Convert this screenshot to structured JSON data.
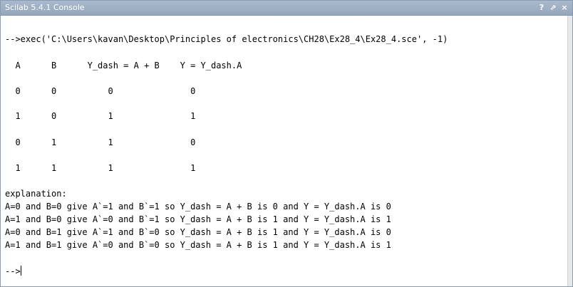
{
  "window": {
    "title": "Scilab 5.4.1 Console",
    "controls": {
      "help": "?",
      "undock": "⇗",
      "close": "×"
    }
  },
  "console": {
    "command": "-->exec('C:\\Users\\kavan\\Desktop\\Principles of electronics\\CH28\\Ex28_4\\Ex28_4.sce', -1)",
    "table_header": "  A      B      Y_dash = A + B    Y = Y_dash.A",
    "table_rows": [
      "  0      0          0               0",
      "  1      0          1               1",
      "  0      1          1               0",
      "  1      1          1               1"
    ],
    "explanation_label": "explanation:",
    "explanation_lines": [
      "A=0 and B=0 give A`=1 and B`=1 so Y_dash = A + B is 0 and Y = Y_dash.A is 0",
      "A=1 and B=0 give A`=0 and B`=1 so Y_dash = A + B is 1 and Y = Y_dash.A is 1",
      "A=0 and B=1 give A`=1 and B`=0 so Y_dash = A + B is 1 and Y = Y_dash.A is 0",
      "A=1 and B=1 give A`=0 and B`=0 so Y_dash = A + B is 1 and Y = Y_dash.A is 1"
    ],
    "prompt": "-->"
  }
}
